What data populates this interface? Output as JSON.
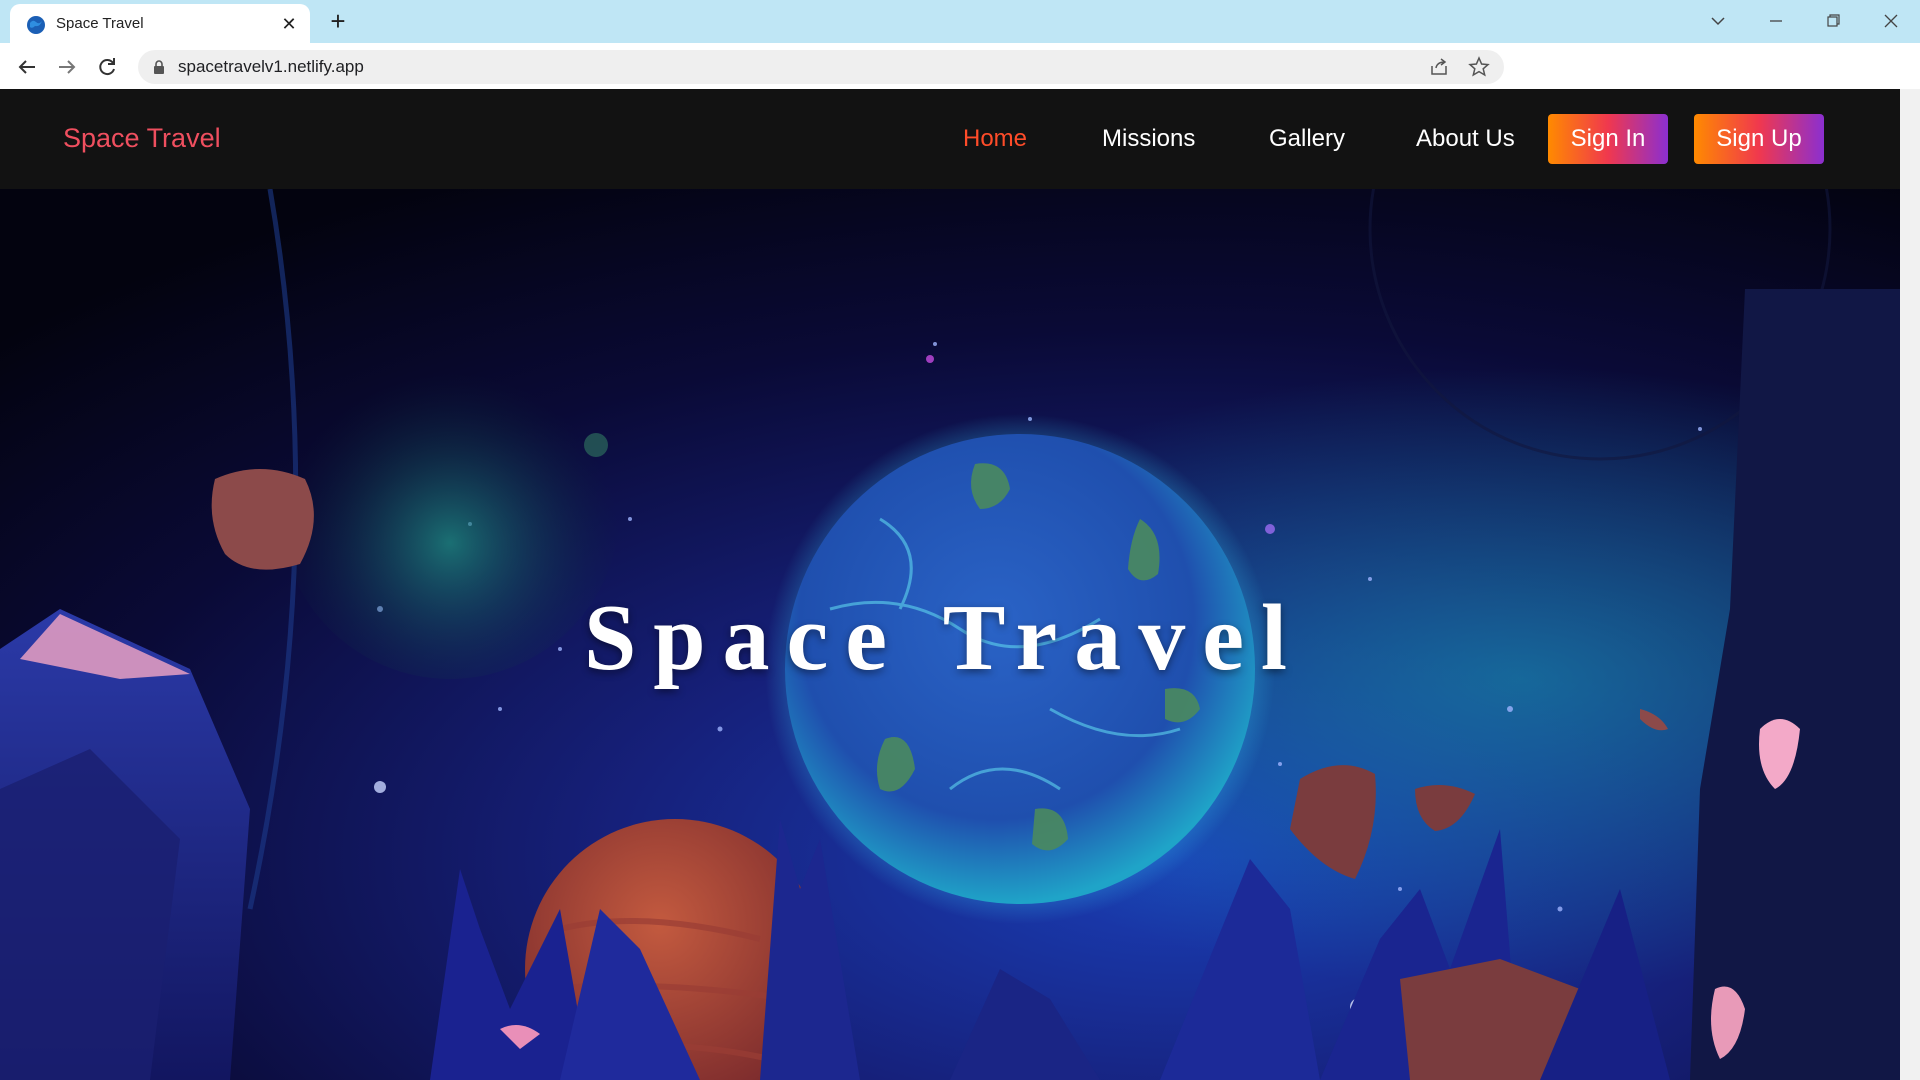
{
  "browser": {
    "tab_title": "Space Travel",
    "url": "spacetravelv1.netlify.app"
  },
  "site": {
    "brand": "Space Travel",
    "nav": [
      {
        "label": "Home",
        "active": true
      },
      {
        "label": "Missions"
      },
      {
        "label": "Gallery"
      },
      {
        "label": "About Us"
      }
    ],
    "sign_in": "Sign In",
    "sign_up": "Sign Up",
    "hero_title": "Space Travel"
  },
  "colors": {
    "brand": "#ef4f5f",
    "active_nav": "#ff4c29",
    "navbar_bg": "#121212"
  }
}
